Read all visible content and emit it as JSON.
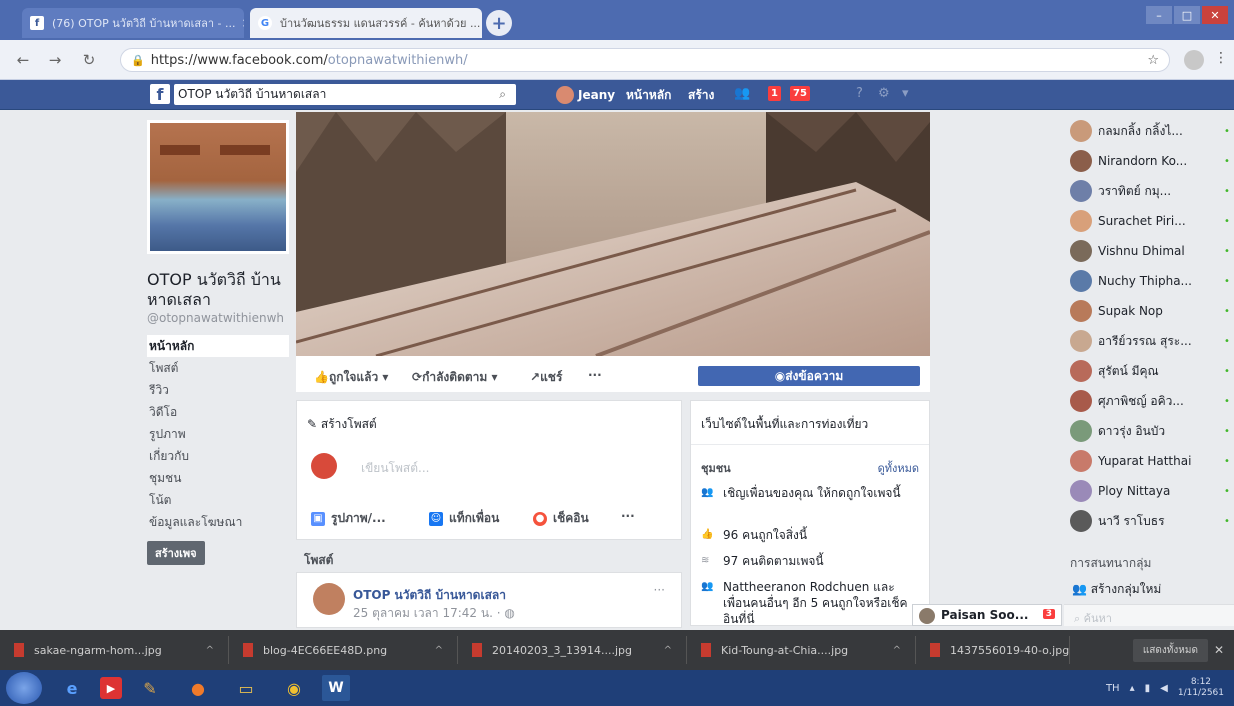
{
  "browser": {
    "tabs": [
      {
        "label": "(76) OTOP นวัตวิถี บ้านหาดเสลา - ...",
        "icon": "facebook-icon"
      },
      {
        "label": "บ้านวัฒนธรรม แดนสวรรค์ - ค้นหาด้วย ...",
        "icon": "google-icon"
      }
    ],
    "url_host": "https://www.facebook.com/",
    "url_path": "otopnawatwithienwh/"
  },
  "fb_header": {
    "logo": "f",
    "search_value": "OTOP นวัตวิถี บ้านหาดเสลา",
    "user_name": "Jeany",
    "home_label": "หน้าหลัก",
    "create_label": "สร้าง",
    "friend_badge": "1",
    "notif_badge": "75"
  },
  "page": {
    "name": "OTOP นวัตวิถี บ้านหาดเสลา",
    "handle": "@otopnawatwithienwh",
    "nav": [
      "หน้าหลัก",
      "โพสต์",
      "รีวิว",
      "วิดีโอ",
      "รูปภาพ",
      "เกี่ยวกับ",
      "ชุมชน",
      "โน้ต",
      "ข้อมูลและโฆษณา"
    ],
    "create_page": "สร้างเพจ"
  },
  "actions": {
    "like": "ถูกใจแล้ว ▾",
    "follow": "กำลังติดตาม ▾",
    "share": "แชร์",
    "more": "···",
    "message": "ส่งข้อความ"
  },
  "composer": {
    "title": "สร้างโพสต์",
    "placeholder": "เขียนโพสต์...",
    "photo": "รูปภาพ/...",
    "tag": "แท็กเพื่อน",
    "checkin": "เช็คอิน",
    "more": "···"
  },
  "posts": {
    "heading": "โพสต์",
    "author": "OTOP นวัตวิถี บ้านหาดเสลา",
    "time": "25 ตุลาคม เวลา 17:42 น. · ◍"
  },
  "sidebar_info": {
    "category": "เว็บไซต์ในพื้นที่และการท่องเที่ยว",
    "community": "ชุมชน",
    "see_all": "ดูทั้งหมด",
    "items": [
      "เชิญเพื่อนของคุณ ให้กดถูกใจเพจนี้",
      "96 คนถูกใจสิ่งนี้",
      "97 คนติดตามเพจนี้",
      "Nattheeranon Rodchuen และเพื่อนคนอื่นๆ อีก 5 คนถูกใจหรือเช็คอินที่นี่"
    ]
  },
  "chat": {
    "contacts": [
      {
        "name": "กลมกลิ้ง กลิ้งไ...",
        "color": "#c99a7a"
      },
      {
        "name": "Nirandorn Ko...",
        "color": "#8b5e4a"
      },
      {
        "name": "วราทิตย์ กมุ...",
        "color": "#6e7fa8"
      },
      {
        "name": "Surachet Piri...",
        "color": "#d8a07a"
      },
      {
        "name": "Vishnu Dhimal",
        "color": "#7a6a5a"
      },
      {
        "name": "Nuchy Thipha...",
        "color": "#5a7aa8"
      },
      {
        "name": "Supak Nop",
        "color": "#b87a5a"
      },
      {
        "name": "อารีย์วรรณ สุระ...",
        "color": "#c8a890"
      },
      {
        "name": "สุรัตน์ มีคุณ",
        "color": "#b86a5a"
      },
      {
        "name": "ศุภาพิชญ์ อคิว...",
        "color": "#a85a4a"
      },
      {
        "name": "ดาวรุ่ง อินบัว",
        "color": "#7a9a7a"
      },
      {
        "name": "Yuparat Hatthai",
        "color": "#c87a6a"
      },
      {
        "name": "Ploy Nittaya",
        "color": "#9a8ab8"
      },
      {
        "name": "นาวี ราโบธร",
        "color": "#5a5a5a"
      }
    ],
    "groups_heading": "การสนทนากลุ่ม",
    "create_group": "สร้างกลุ่มใหม่",
    "search_placeholder": "ค้นหา",
    "open_chat": "Paisan Soo...",
    "open_chat_badge": "3"
  },
  "downloads": {
    "files": [
      "sakae-ngarm-hom...jpg",
      "blog-4EC66EE48D.png",
      "20140203_3_13914....jpg",
      "Kid-Toung-at-Chia....jpg",
      "1437556019-40-o.jpg"
    ],
    "show_all": "แสดงทั้งหมด"
  },
  "taskbar": {
    "lang": "TH",
    "time": "8:12",
    "date": "1/11/2561"
  }
}
